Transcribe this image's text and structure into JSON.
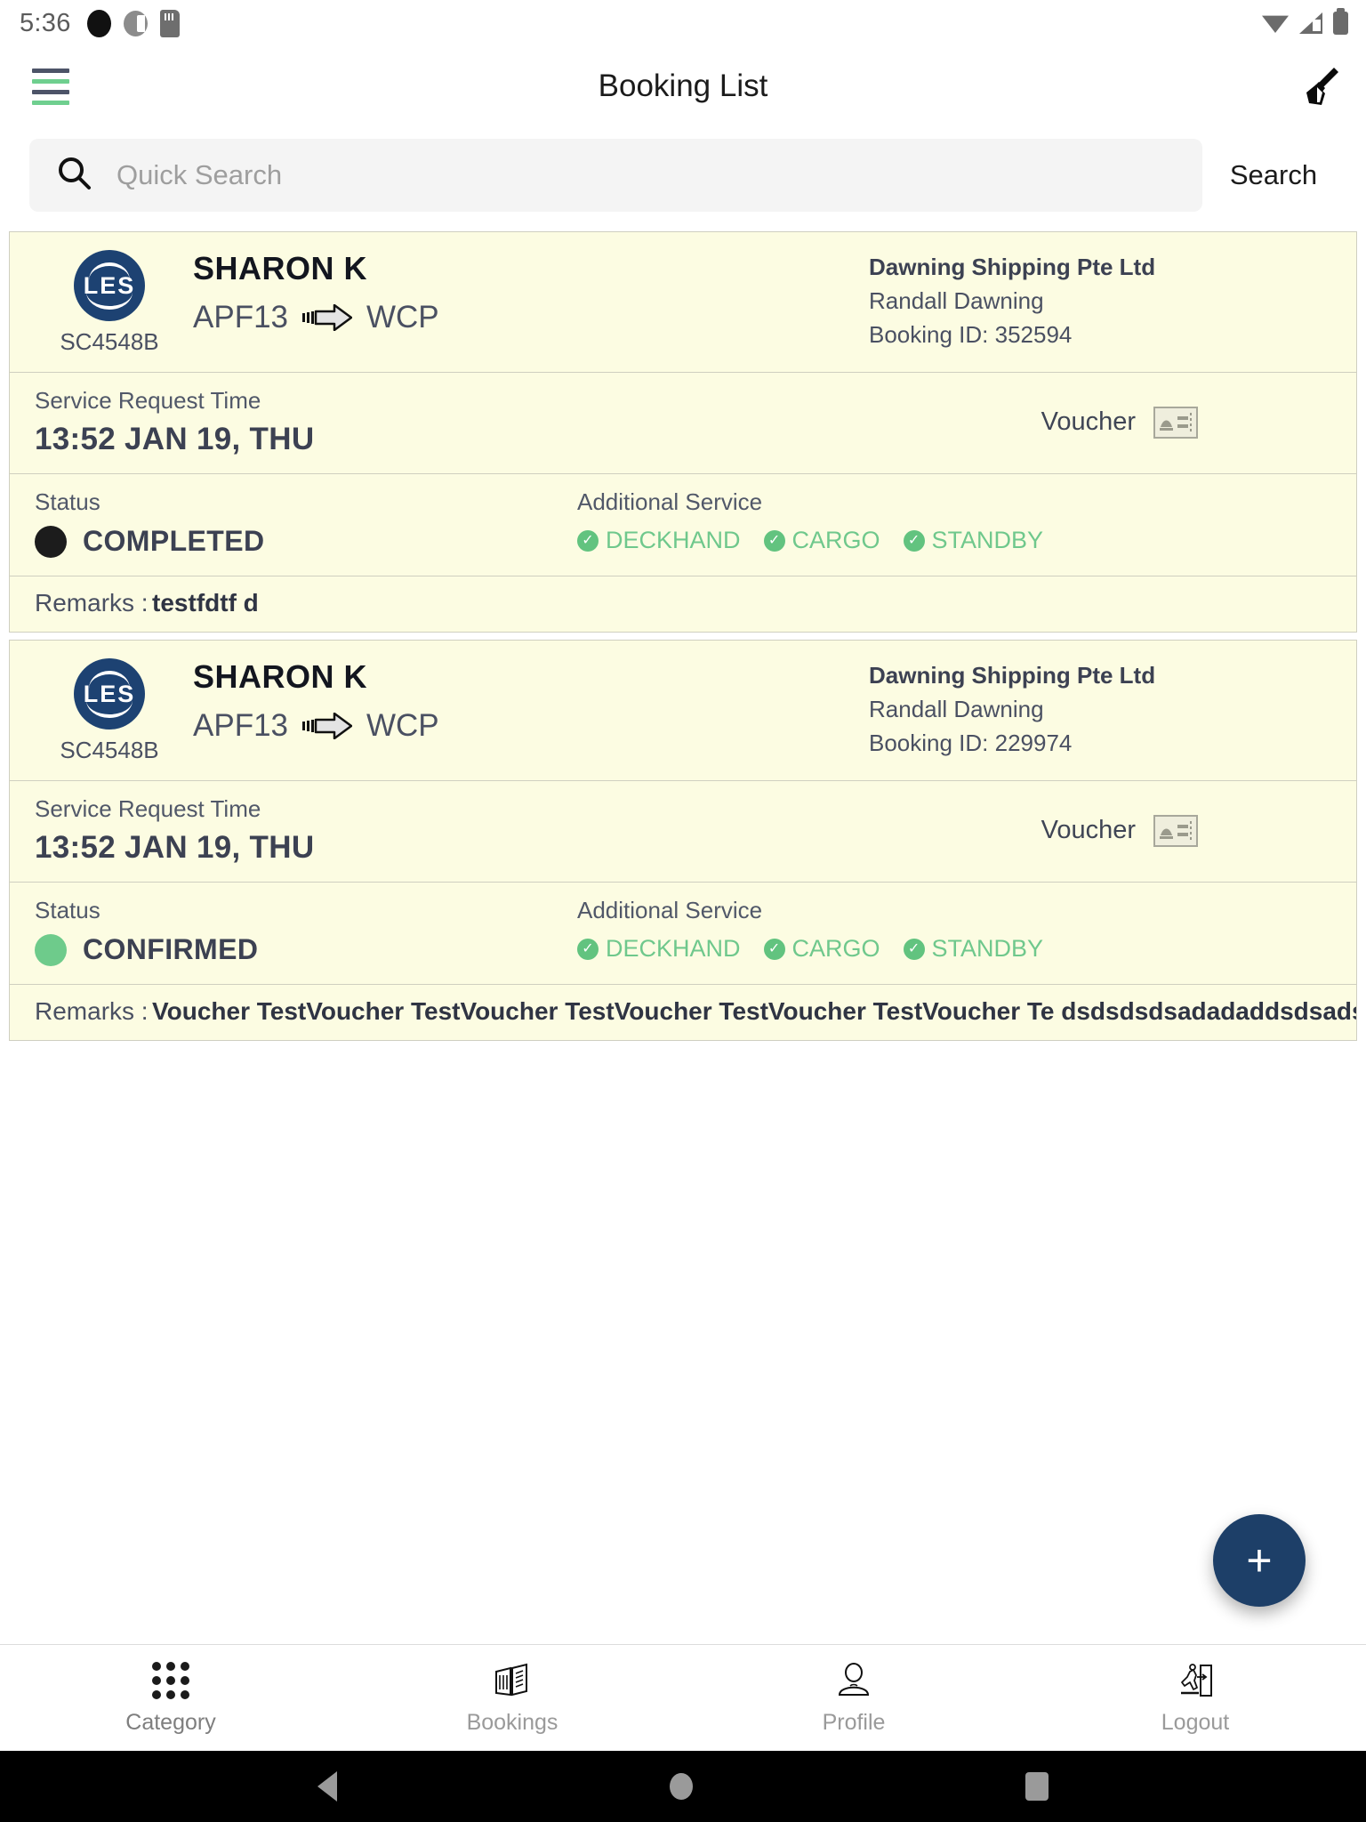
{
  "status_bar": {
    "time": "5:36",
    "left_icons": [
      "record-dot-icon",
      "do-not-disturb-icon",
      "sd-card-icon"
    ],
    "right_icons": [
      "wifi-icon",
      "cellular-signal-icon",
      "battery-icon"
    ]
  },
  "app_bar": {
    "menu_icon": "hamburger-menu-icon",
    "title": "Booking List",
    "action_icon": "broom-clear-icon"
  },
  "search": {
    "icon": "search-icon",
    "placeholder": "Quick Search",
    "value": "",
    "button_label": "Search"
  },
  "labels": {
    "service_request_time": "Service Request Time",
    "voucher": "Voucher",
    "status": "Status",
    "additional_service": "Additional Service",
    "remarks_prefix": "Remarks :"
  },
  "colors": {
    "accent_navy": "#1d3f68",
    "card_background": "#fcfce2",
    "card_border": "#cfcfc0",
    "status_completed": "#1c1c1c",
    "status_confirmed": "#6ecb8b",
    "service_green": "#6fc88c",
    "menu_green": "#6fcf8f",
    "text_dark": "#3c4152"
  },
  "bookings": [
    {
      "logo_text": "LES",
      "vessel_code": "SC4548B",
      "vessel_name": "SHARON K",
      "route_from": "APF13",
      "route_arrow_icon": "arrow-right-icon",
      "route_to": "WCP",
      "company": "Dawning Shipping Pte Ltd",
      "contact": "Randall Dawning",
      "booking_id": "Booking ID: 352594",
      "service_request_time": "13:52 JAN 19, THU",
      "voucher_icon": "voucher-ticket-icon",
      "status": "COMPLETED",
      "status_color": "#1c1c1c",
      "additional_services": [
        "DECKHAND",
        "CARGO",
        "STANDBY"
      ],
      "remarks": "testfdtf  d"
    },
    {
      "logo_text": "LES",
      "vessel_code": "SC4548B",
      "vessel_name": "SHARON K",
      "route_from": "APF13",
      "route_arrow_icon": "arrow-right-icon",
      "route_to": "WCP",
      "company": "Dawning Shipping Pte Ltd",
      "contact": "Randall Dawning",
      "booking_id": "Booking ID: 229974",
      "service_request_time": "13:52 JAN 19, THU",
      "voucher_icon": "voucher-ticket-icon",
      "status": "CONFIRMED",
      "status_color": "#6ecb8b",
      "additional_services": [
        "DECKHAND",
        "CARGO",
        "STANDBY"
      ],
      "remarks": "Voucher TestVoucher TestVoucher TestVoucher TestVoucher TestVoucher Te dsdsdsdsadadaddsdsadsdsadadasdsadsadasdasdasdas"
    }
  ],
  "fab": {
    "icon": "plus-icon",
    "label": "+"
  },
  "bottom_nav": [
    {
      "icon": "grid-dots-icon",
      "label": "Category",
      "active": true
    },
    {
      "icon": "book-open-icon",
      "label": "Bookings",
      "active": false
    },
    {
      "icon": "person-icon",
      "label": "Profile",
      "active": false
    },
    {
      "icon": "logout-door-icon",
      "label": "Logout",
      "active": false
    }
  ],
  "android_nav": {
    "back": "back-triangle-icon",
    "home": "home-circle-icon",
    "recents": "recents-square-icon"
  }
}
